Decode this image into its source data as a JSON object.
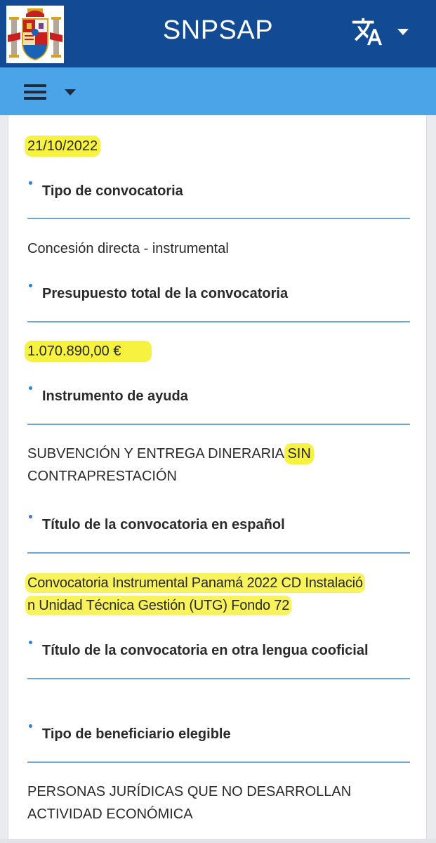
{
  "header": {
    "brand": "SNPSAP",
    "translate_icon": "translate-icon",
    "crest_icon": "spain-coat-of-arms"
  },
  "navbar": {
    "menu_icon": "hamburger-icon"
  },
  "fields": [
    {
      "value": "21/10/2022"
    },
    {
      "label": "Tipo de convocatoria",
      "value": "Concesión directa - instrumental"
    },
    {
      "label": "Presupuesto total de la convocatoria",
      "value": "1.070.890,00 €"
    },
    {
      "label": "Instrumento de ayuda",
      "value_line1_a": "SUBVENCIÓN Y ENTREGA DINERARIA ",
      "value_line1_b": "SIN",
      "value_line2": "CONTRAPRESTACIÓN"
    },
    {
      "label": "Título de la convocatoria en español",
      "value_line1": "Convocatoria Instrumental Panamá 2022 CD Instalació",
      "value_line2": "n Unidad Técnica Gestión (UTG) Fondo 72"
    },
    {
      "label": "Título de la convocatoria en otra lengua cooficial",
      "value": ""
    },
    {
      "label": "Tipo de beneficiario elegible",
      "value_line1": "PERSONAS JURÍDICAS QUE NO DESARROLLAN",
      "value_line2": "ACTIVIDAD ECONÓMICA"
    }
  ],
  "colors": {
    "header_bg": "#124a94",
    "nav_bg": "#4ba3e8",
    "rule": "#6ea5d8",
    "highlight": "#f7f140"
  }
}
